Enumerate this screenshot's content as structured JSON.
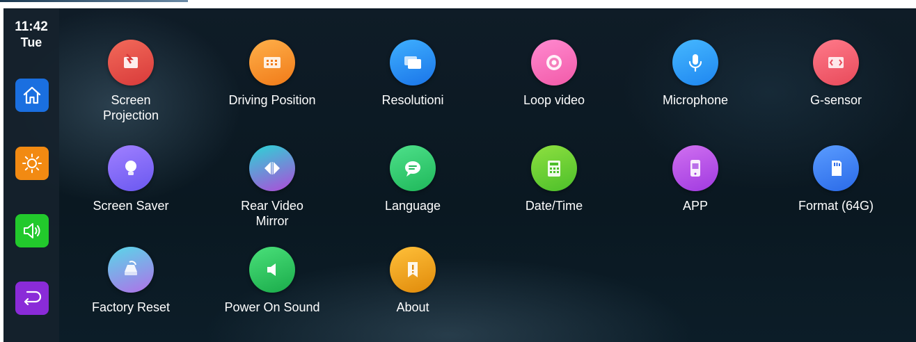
{
  "clock": {
    "time": "11:42",
    "day": "Tue"
  },
  "sidebar": {
    "buttons": [
      {
        "icon": "home-icon",
        "color": "#1a6fe0"
      },
      {
        "icon": "brightness-icon",
        "color": "#f28a12"
      },
      {
        "icon": "volume-icon",
        "color": "#22c92c"
      },
      {
        "icon": "back-icon",
        "color": "#8a2bd8"
      }
    ]
  },
  "settings": {
    "items": [
      {
        "label": "Screen\nProjection",
        "icon": "screen-projection-icon",
        "colors": [
          "#f26a5a",
          "#d83a3a"
        ]
      },
      {
        "label": "Driving Position",
        "icon": "driving-position-icon",
        "colors": [
          "#ffb04a",
          "#f07a18"
        ]
      },
      {
        "label": "Resolutioni",
        "icon": "resolution-icon",
        "colors": [
          "#3fb0ff",
          "#1a74e8"
        ]
      },
      {
        "label": "Loop video",
        "icon": "loop-video-icon",
        "colors": [
          "#ff8ad0",
          "#f25aa8"
        ]
      },
      {
        "label": "Microphone",
        "icon": "microphone-icon",
        "colors": [
          "#46b8ff",
          "#1e86f0"
        ]
      },
      {
        "label": "G-sensor",
        "icon": "g-sensor-icon",
        "colors": [
          "#ff7a8a",
          "#e84a5a"
        ]
      },
      {
        "label": "Screen Saver",
        "icon": "screen-saver-icon",
        "colors": [
          "#a080ff",
          "#6a58f0"
        ]
      },
      {
        "label": "Rear Video\nMirror",
        "icon": "rear-video-mirror-icon",
        "colors": [
          "#2ad6d6",
          "#b04ad8"
        ]
      },
      {
        "label": "Language",
        "icon": "language-icon",
        "colors": [
          "#4ee08a",
          "#1fb85a"
        ]
      },
      {
        "label": "Date/Time",
        "icon": "date-time-icon",
        "colors": [
          "#8ee040",
          "#4cbf2a"
        ]
      },
      {
        "label": "APP",
        "icon": "app-icon",
        "colors": [
          "#d070f0",
          "#a03ae0"
        ]
      },
      {
        "label": "Format (64G)",
        "icon": "format-sd-icon",
        "colors": [
          "#5a9cff",
          "#2a6ae8"
        ]
      },
      {
        "label": "Factory Reset",
        "icon": "factory-reset-icon",
        "colors": [
          "#58d8e8",
          "#b070e8"
        ]
      },
      {
        "label": "Power On Sound",
        "icon": "power-on-sound-icon",
        "colors": [
          "#4ae07a",
          "#1aab4a"
        ]
      },
      {
        "label": "About",
        "icon": "about-icon",
        "colors": [
          "#ffc03a",
          "#e08a0a"
        ]
      }
    ]
  }
}
